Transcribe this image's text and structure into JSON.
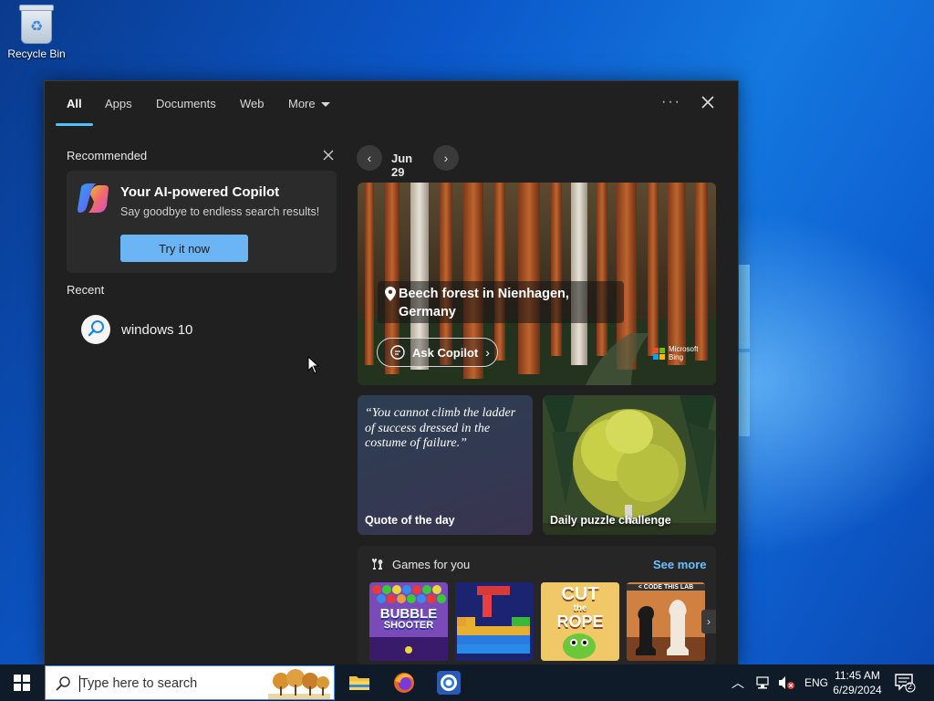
{
  "desktop": {
    "recycle_bin_label": "Recycle Bin"
  },
  "search_panel": {
    "tabs": [
      {
        "label": "All",
        "active": true
      },
      {
        "label": "Apps"
      },
      {
        "label": "Documents"
      },
      {
        "label": "Web"
      },
      {
        "label": "More"
      }
    ],
    "more_options": "···",
    "recommended": {
      "title": "Recommended",
      "copilot_title": "Your AI-powered Copilot",
      "copilot_subtitle": "Say goodbye to endless search results!",
      "try_button": "Try it now"
    },
    "recent": {
      "title": "Recent",
      "items": [
        {
          "label": "windows 10",
          "icon": "search-icon"
        }
      ]
    },
    "highlights": {
      "date": "Jun 29",
      "hero_location": "Beech forest in Nienhagen, Germany",
      "ask_copilot": "Ask Copilot",
      "bing_line1": "Microsoft",
      "bing_line2": "Bing",
      "quote": "“You cannot climb the ladder of success dressed in the costume of failure.”",
      "quote_label": "Quote of the day",
      "puzzle_label": "Daily puzzle challenge"
    },
    "games": {
      "title": "Games for you",
      "see_more": "See more",
      "tiles": [
        {
          "name": "Bubble Shooter",
          "line1": "BUBBLE",
          "line2": "SHOOTER"
        },
        {
          "name": "Block puzzle"
        },
        {
          "name": "Cut the Rope",
          "line1": "CUT",
          "line2": "the",
          "line3": "ROPE"
        },
        {
          "name": "Chess",
          "badge": "< CODE THIS LAB"
        }
      ]
    }
  },
  "taskbar": {
    "search_placeholder": "Type here to search",
    "apps": [
      "file-explorer",
      "firefox",
      "chrome"
    ],
    "language": "ENG",
    "time": "11:45 AM",
    "date": "6/29/2024",
    "notification_count": "2"
  },
  "colors": {
    "accent": "#4cc2ff",
    "try_button": "#6cb5f5",
    "link": "#6cc0ff",
    "panel_bg": "#202020"
  }
}
